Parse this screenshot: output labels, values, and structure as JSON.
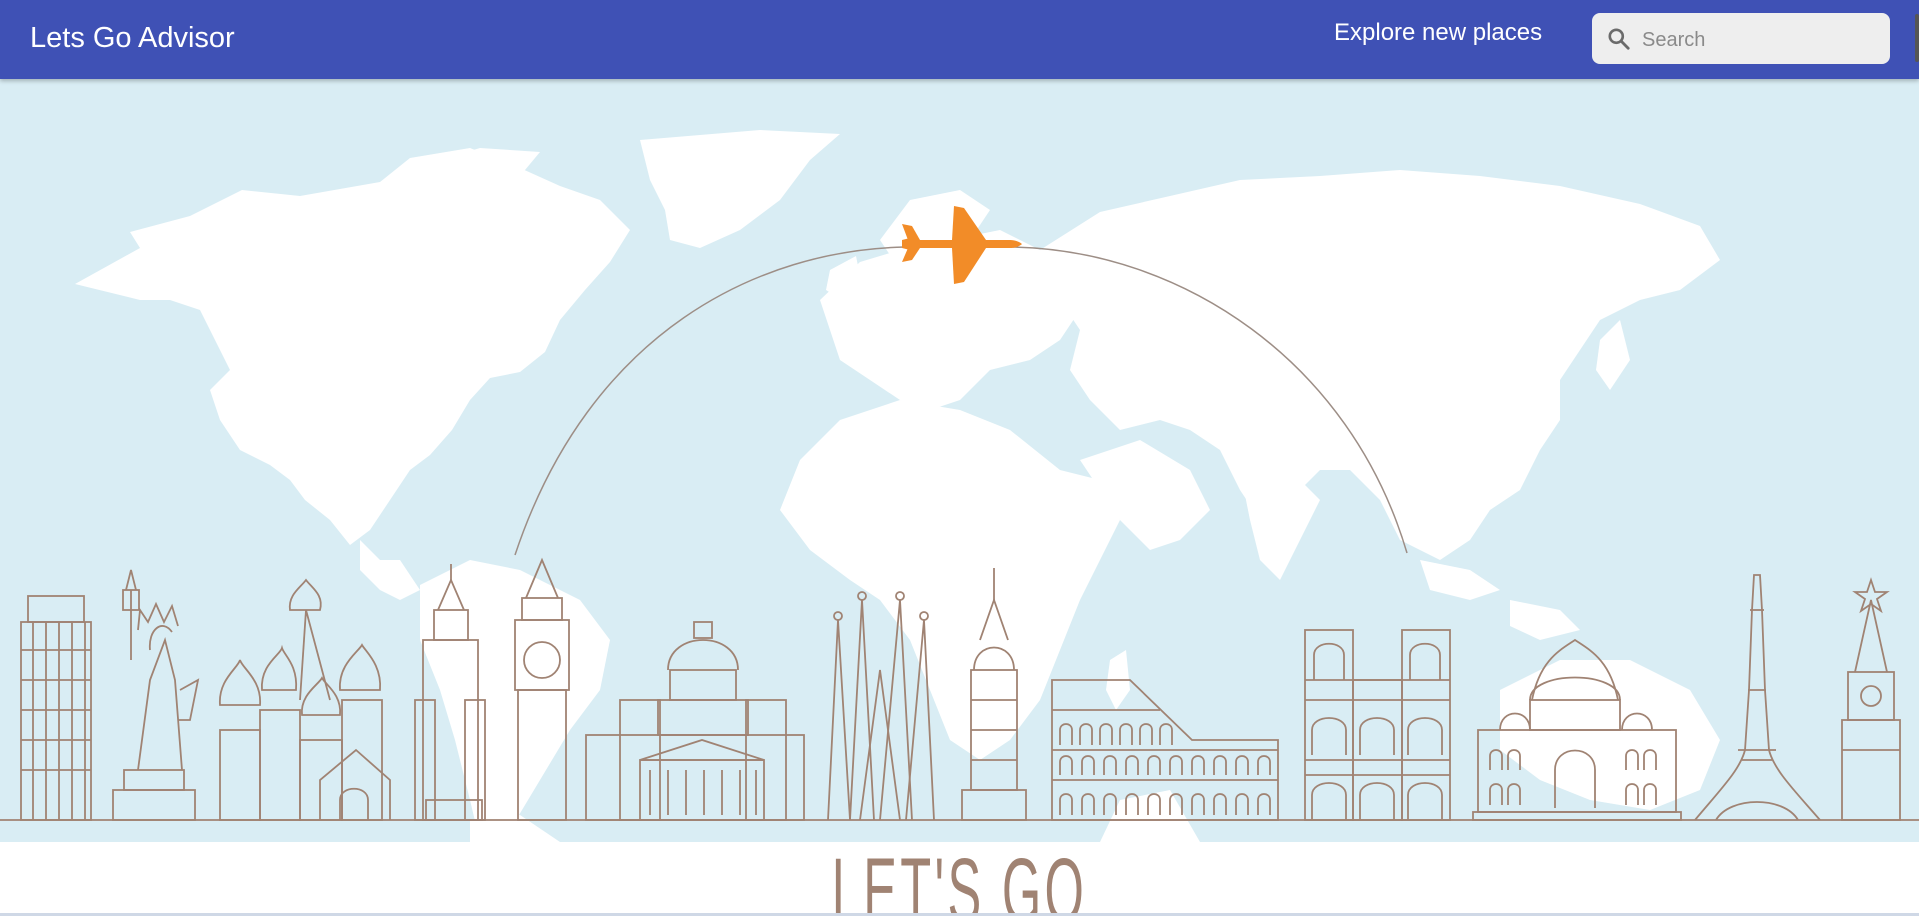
{
  "app": {
    "title": "Lets Go Advisor"
  },
  "nav": {
    "explore_label": "Explore new places"
  },
  "search": {
    "placeholder": "Search",
    "value": "",
    "icon": "search-icon"
  },
  "hero": {
    "headline": "LET'S GO",
    "plane_icon": "airplane-icon",
    "landmarks": [
      "leaning-tower-of-pisa",
      "statue-of-liberty",
      "st-basils-cathedral",
      "empire-state-building",
      "big-ben",
      "capitol-dome",
      "sagrada-familia",
      "chrysler-building",
      "colosseum",
      "notre-dame",
      "taj-mahal",
      "eiffel-tower",
      "kremlin-tower"
    ]
  },
  "colors": {
    "appbar": "#3f51b5",
    "hero_background": "#d9edf4",
    "landmark_stroke": "#a08373",
    "plane": "#f28c28"
  }
}
